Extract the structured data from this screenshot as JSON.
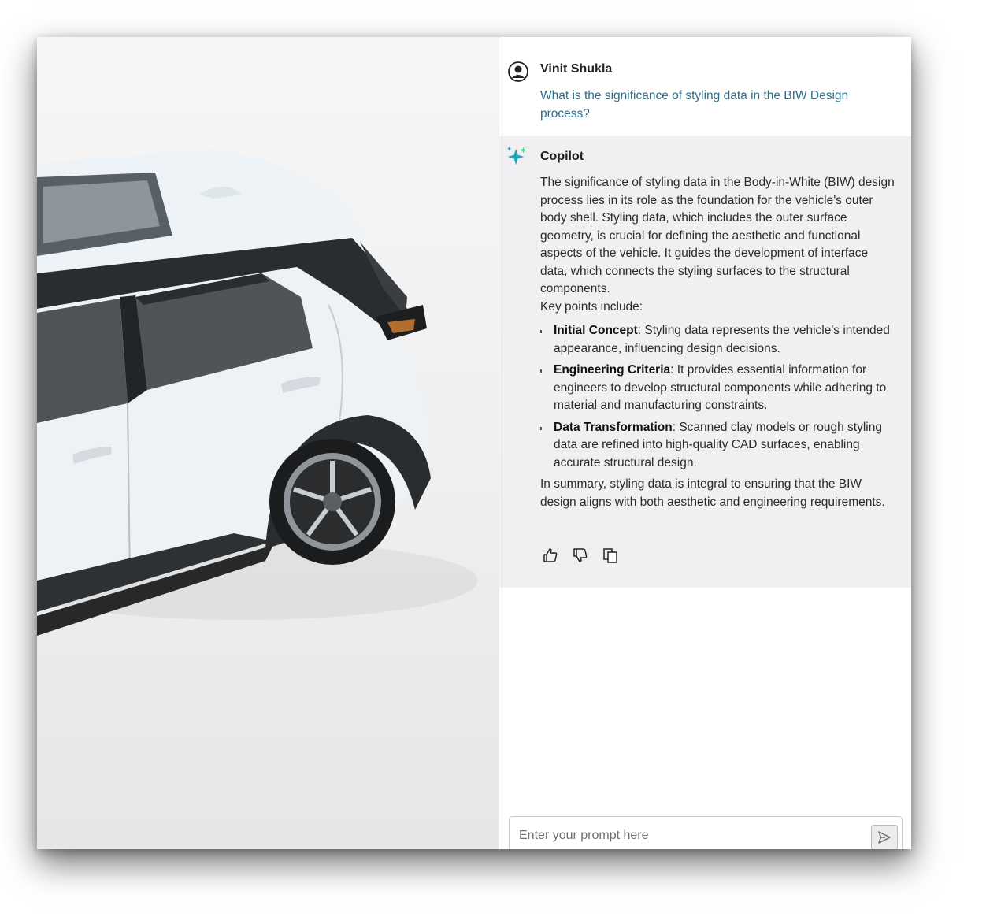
{
  "colors": {
    "user_text": "#2a6f8a",
    "copilot_bg": "#f1eff1",
    "sparkle_primary": "#1aa5b8",
    "sparkle_accent": "#2fd07a"
  },
  "viewport": {
    "icon": "car-3d-model"
  },
  "conversation": {
    "user": {
      "name": "Vinit Shukla",
      "icon": "user-avatar-icon",
      "text": "What is the significance of styling data in the BIW Design process?"
    },
    "copilot": {
      "name": "Copilot",
      "icon": "sparkle-icon",
      "intro": "The significance of styling data in the Body-in-White (BIW) design process lies in its role as the foundation for the vehicle's outer body shell. Styling data, which includes the outer surface geometry, is crucial for defining the aesthetic and functional aspects of the vehicle. It guides the development of interface data, which connects the styling surfaces to the structural components.",
      "key_points_label": "Key points include:",
      "points": [
        {
          "title": "Initial Concept",
          "text": ": Styling data represents the vehicle's intended appearance, influencing design decisions."
        },
        {
          "title": "Engineering Criteria",
          "text": ": It provides essential information for engineers to develop structural components while adhering to material and manufacturing constraints."
        },
        {
          "title": "Data Transformation",
          "text": ": Scanned clay models or rough styling data are refined into high-quality CAD surfaces, enabling accurate structural design."
        }
      ],
      "summary": "In summary, styling data is integral to ensuring that the BIW design aligns with both aesthetic and engineering requirements.",
      "actions": [
        {
          "name": "thumbs-up-icon"
        },
        {
          "name": "thumbs-down-icon"
        },
        {
          "name": "copy-icon"
        }
      ]
    }
  },
  "prompt": {
    "placeholder": "Enter your prompt here",
    "value": "",
    "send_icon": "send-icon"
  }
}
